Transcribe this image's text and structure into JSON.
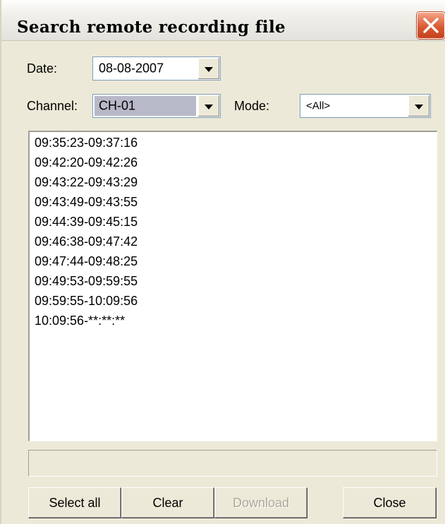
{
  "window": {
    "title": "Search remote recording file",
    "close_icon": "close-x-icon"
  },
  "form": {
    "date_label": "Date:",
    "date_value": "08-08-2007",
    "channel_label": "Channel:",
    "channel_value": "CH-01",
    "mode_label": "Mode:",
    "mode_value": "<All>"
  },
  "recordings": [
    "09:35:23-09:37:16",
    "09:42:20-09:42:26",
    "09:43:22-09:43:29",
    "09:43:49-09:43:55",
    "09:44:39-09:45:15",
    "09:46:38-09:47:42",
    "09:47:44-09:48:25",
    "09:49:53-09:59:55",
    "09:59:55-10:09:56",
    "10:09:56-**:**:**"
  ],
  "status_text": "",
  "buttons": {
    "select_all": "Select all",
    "clear": "Clear",
    "download": "Download",
    "close": "Close"
  },
  "colors": {
    "window_bg": "#ece9d8",
    "close_button": "#d95b34",
    "selected_combo_bg": "#b8b9c8"
  }
}
